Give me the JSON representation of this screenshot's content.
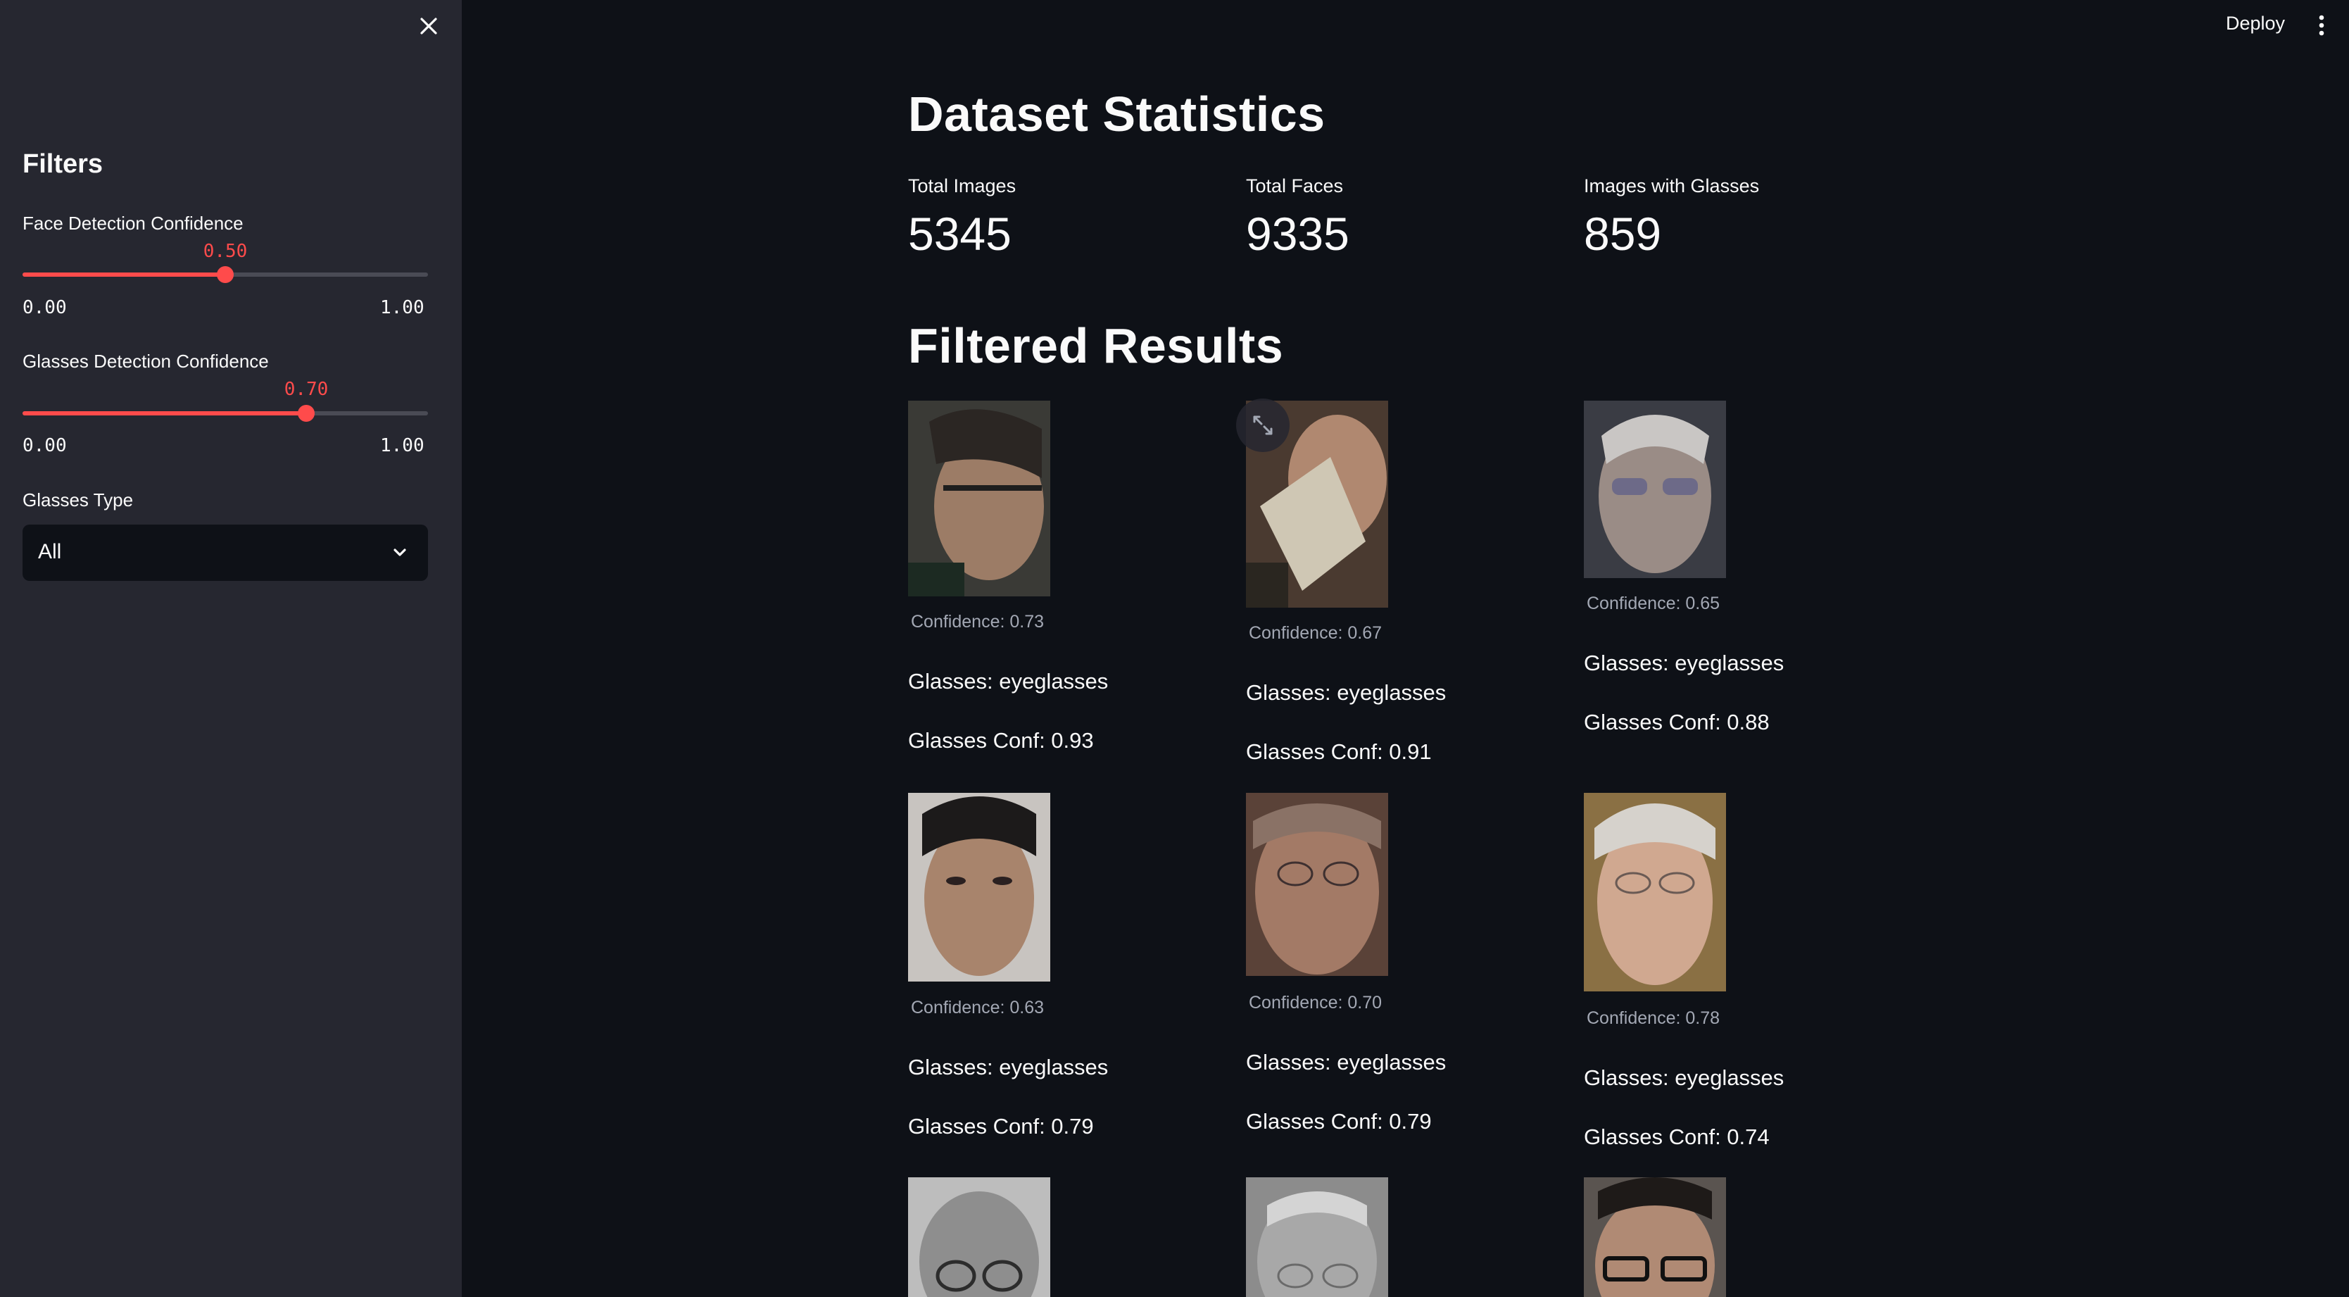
{
  "sidebar": {
    "title": "Filters",
    "face_slider": {
      "label": "Face Detection Confidence",
      "value": "0.50",
      "fraction": 0.5,
      "min": "0.00",
      "max": "1.00"
    },
    "glasses_slider": {
      "label": "Glasses Detection Confidence",
      "value": "0.70",
      "fraction": 0.7,
      "min": "0.00",
      "max": "1.00"
    },
    "glasses_type": {
      "label": "Glasses Type",
      "value": "All"
    }
  },
  "header": {
    "deploy_label": "Deploy"
  },
  "stats": {
    "title": "Dataset Statistics",
    "metrics": [
      {
        "label": "Total Images",
        "value": "5345"
      },
      {
        "label": "Total Faces",
        "value": "9335"
      },
      {
        "label": "Images with Glasses",
        "value": "859"
      }
    ]
  },
  "results": {
    "title": "Filtered Results",
    "cards": [
      {
        "confidence": "Confidence: 0.73",
        "glasses": "Glasses: eyeglasses",
        "glasses_conf": "Glasses Conf: 0.93"
      },
      {
        "confidence": "Confidence: 0.67",
        "glasses": "Glasses: eyeglasses",
        "glasses_conf": "Glasses Conf: 0.91"
      },
      {
        "confidence": "Confidence: 0.65",
        "glasses": "Glasses: eyeglasses",
        "glasses_conf": "Glasses Conf: 0.88"
      },
      {
        "confidence": "Confidence: 0.63",
        "glasses": "Glasses: eyeglasses",
        "glasses_conf": "Glasses Conf: 0.79"
      },
      {
        "confidence": "Confidence: 0.70",
        "glasses": "Glasses: eyeglasses",
        "glasses_conf": "Glasses Conf: 0.79"
      },
      {
        "confidence": "Confidence: 0.78",
        "glasses": "Glasses: eyeglasses",
        "glasses_conf": "Glasses Conf: 0.74"
      }
    ]
  },
  "colors": {
    "accent": "#ff4b4b",
    "sidebar_bg": "#262730",
    "main_bg": "#0e1117"
  },
  "icons": {
    "close": "close-icon",
    "chevron": "chevron-down-icon",
    "menu": "more-vertical-icon",
    "expand": "fullscreen-icon"
  }
}
